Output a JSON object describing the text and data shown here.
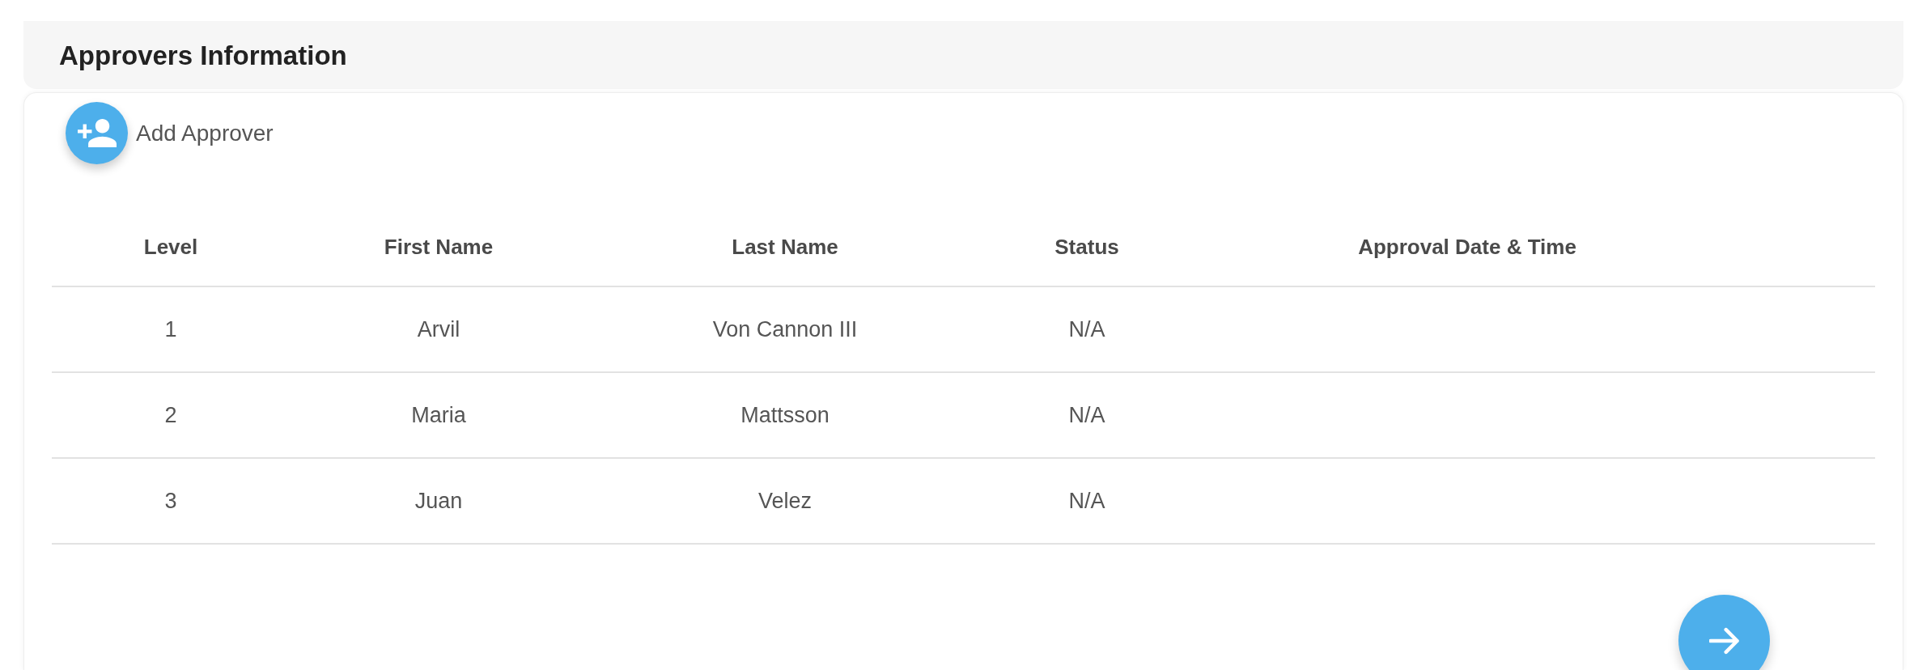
{
  "section": {
    "title": "Approvers Information"
  },
  "add_approver": {
    "label": "Add Approver"
  },
  "table": {
    "columns": [
      "Level",
      "First Name",
      "Last Name",
      "Status",
      "Approval Date & Time"
    ],
    "rows": [
      {
        "level": "1",
        "first_name": "Arvil",
        "last_name": "Von Cannon III",
        "status": "N/A"
      },
      {
        "level": "2",
        "first_name": "Maria",
        "last_name": "Mattsson",
        "status": "N/A"
      },
      {
        "level": "3",
        "first_name": "Juan",
        "last_name": "Velez",
        "status": "N/A"
      }
    ]
  }
}
